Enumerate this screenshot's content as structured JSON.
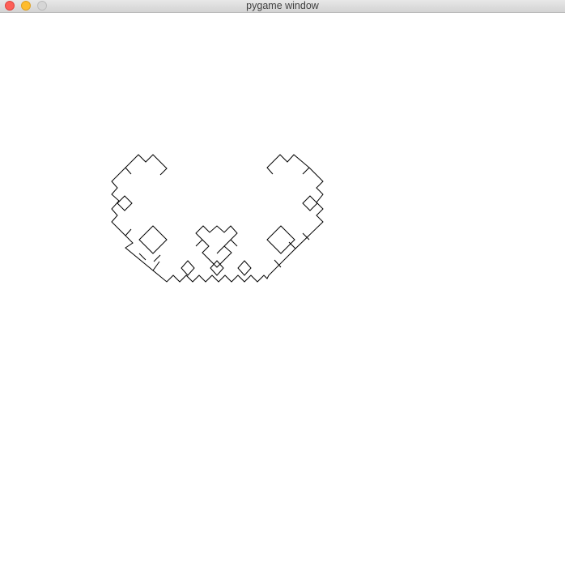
{
  "window": {
    "title": "pygame window",
    "buttons": {
      "close": "close-button",
      "minimize": "minimize-button",
      "maximize": "maximize-button"
    },
    "colors": {
      "close": "#fd5f57",
      "minimize": "#febc2e",
      "maximize": "#d6d6d6"
    }
  },
  "canvas": {
    "background": "#ffffff",
    "stroke_color": "#000000",
    "drawing": "fractal-curve"
  }
}
